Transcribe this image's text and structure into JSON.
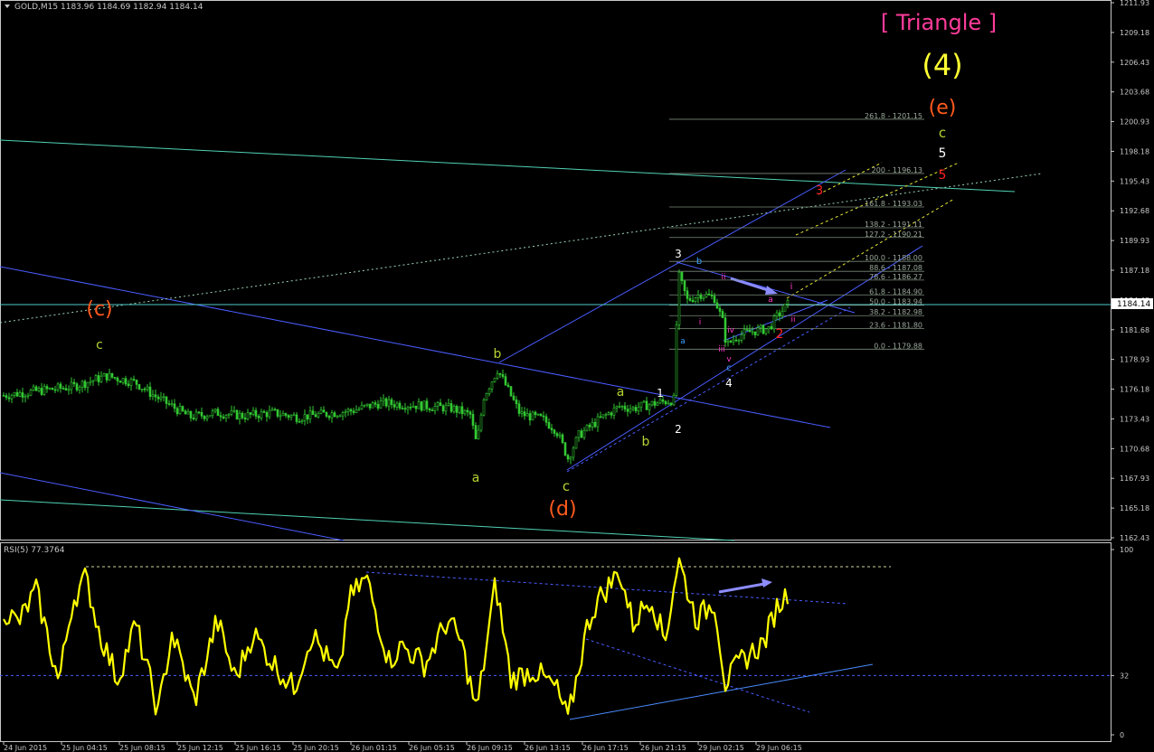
{
  "header": {
    "symbol_text": "GOLD,M15",
    "ohlc_text": "1183.96 1184.69 1182.94 1184.14"
  },
  "price_axis": {
    "ticks": [
      "1211.93",
      "1209.18",
      "1206.43",
      "1203.68",
      "1200.93",
      "1198.18",
      "1195.43",
      "1192.68",
      "1189.93",
      "1187.18",
      "1184.43",
      "1181.68",
      "1178.93",
      "1176.18",
      "1173.43",
      "1170.68",
      "1167.93",
      "1165.18",
      "1162.43"
    ],
    "current_price": "1184.14",
    "ylim": [
      1162.43,
      1211.93
    ]
  },
  "rsi": {
    "title": "RSI(5) 77.3764",
    "ticks": [
      "100",
      "32",
      "0"
    ],
    "levels": [
      100,
      32,
      0
    ]
  },
  "time_axis": {
    "labels": [
      "24 Jun 2015",
      "25 Jun 04:15",
      "25 Jun 08:15",
      "25 Jun 12:15",
      "25 Jun 16:15",
      "25 Jun 20:15",
      "26 Jun 01:15",
      "26 Jun 05:15",
      "26 Jun 09:15",
      "26 Jun 13:15",
      "26 Jun 17:15",
      "26 Jun 21:15",
      "29 Jun 02:15",
      "29 Jun 06:15"
    ]
  },
  "fibonacci": {
    "levels": [
      {
        "label": "261.8 - 1201.15",
        "price": 1201.15
      },
      {
        "label": "200 - 1196.13",
        "price": 1196.13
      },
      {
        "label": "161.8 - 1193.03",
        "price": 1193.03
      },
      {
        "label": "138.2 - 1191.11",
        "price": 1191.11
      },
      {
        "label": "127.2 - 1190.21",
        "price": 1190.21
      },
      {
        "label": "100.0 - 1188.00",
        "price": 1188.0
      },
      {
        "label": "88.6 - 1187.08",
        "price": 1187.08
      },
      {
        "label": "78.6 - 1186.27",
        "price": 1186.27
      },
      {
        "label": "61.8 - 1184.90",
        "price": 1184.9
      },
      {
        "label": "50.0 - 1183.94",
        "price": 1183.94
      },
      {
        "label": "38.2 - 1182.98",
        "price": 1182.98
      },
      {
        "label": "23.6 - 1181.80",
        "price": 1181.8
      },
      {
        "label": "0.0 - 1179.88",
        "price": 1179.88
      }
    ]
  },
  "annotations": [
    {
      "id": "triangle",
      "text": "[ Triangle ]",
      "color": "#ff3c9a"
    },
    {
      "id": "wave-4",
      "text": "(4)",
      "color": "#ffff33"
    },
    {
      "id": "wave-e",
      "text": "(e)",
      "color": "#ff5a1e"
    },
    {
      "id": "wave-c-top",
      "text": "c",
      "color": "#b4d432"
    },
    {
      "id": "wave-5-white",
      "text": "5",
      "color": "#ffffff"
    },
    {
      "id": "wave-5-red",
      "text": "5",
      "color": "#ff2020"
    },
    {
      "id": "wave-3-red",
      "text": "3",
      "color": "#ff2020"
    },
    {
      "id": "wave-paren-c",
      "text": "(c)",
      "color": "#ff5a1e"
    },
    {
      "id": "wave-c-left",
      "text": "c",
      "color": "#b4d432"
    },
    {
      "id": "wave-b-mid",
      "text": "b",
      "color": "#b4d432"
    },
    {
      "id": "wave-a-mid",
      "text": "a",
      "color": "#b4d432"
    },
    {
      "id": "wave-c-bottom",
      "text": "c",
      "color": "#b4d432"
    },
    {
      "id": "wave-paren-d",
      "text": "(d)",
      "color": "#ff5a1e"
    },
    {
      "id": "wave-a-right",
      "text": "a",
      "color": "#b4d432"
    },
    {
      "id": "wave-b-right",
      "text": "b",
      "color": "#b4d432"
    },
    {
      "id": "wave-1-white",
      "text": "1",
      "color": "#ffffff"
    },
    {
      "id": "wave-2-white",
      "text": "2",
      "color": "#ffffff"
    },
    {
      "id": "wave-3-white",
      "text": "3",
      "color": "#ffffff"
    },
    {
      "id": "wave-4-white",
      "text": "4",
      "color": "#ffffff"
    },
    {
      "id": "wave-2-red",
      "text": "2",
      "color": "#ff2020"
    },
    {
      "id": "wave-b-blue",
      "text": "b",
      "color": "#3aa0ff"
    },
    {
      "id": "wave-a-blue",
      "text": "a",
      "color": "#3aa0ff"
    },
    {
      "id": "wave-c-blue",
      "text": "c",
      "color": "#3aa0ff"
    },
    {
      "id": "wave-i-top",
      "text": "i",
      "color": "#ff3cc8"
    },
    {
      "id": "wave-i-small",
      "text": "i",
      "color": "#ff3cc8"
    },
    {
      "id": "wave-ii-small",
      "text": "ii",
      "color": "#ff3cc8"
    },
    {
      "id": "wave-iii-small",
      "text": "iii",
      "color": "#ff3cc8"
    },
    {
      "id": "wave-iv-small",
      "text": "iv",
      "color": "#ff3cc8"
    },
    {
      "id": "wave-v-small",
      "text": "v",
      "color": "#ff3cc8"
    },
    {
      "id": "wave-ii-right",
      "text": "ii",
      "color": "#ff3cc8"
    },
    {
      "id": "wave-a-mini",
      "text": "a",
      "color": "#ff3cc8"
    }
  ],
  "colors": {
    "background": "#000000",
    "candles": "#32c832",
    "rsi_line": "#ffff00",
    "channel_lines": "#4a5cff",
    "trend_teal": "#50d2b4",
    "fib_lines": "#7a8a7a",
    "axis_text": "#c8c8c8"
  },
  "chart_data": [
    {
      "type": "candlestick",
      "title": "GOLD,M15",
      "ylim": [
        1162.43,
        1211.93
      ],
      "x": [
        "24 Jun 2015",
        "25 Jun 04:15",
        "25 Jun 08:15",
        "25 Jun 12:15",
        "25 Jun 16:15",
        "25 Jun 20:15",
        "26 Jun 01:15",
        "26 Jun 05:15",
        "26 Jun 09:15",
        "26 Jun 13:15",
        "26 Jun 17:15",
        "26 Jun 21:15",
        "29 Jun 02:15",
        "29 Jun 06:15"
      ],
      "close_path": [
        [
          "24 Jun 2015",
          1175.6
        ],
        [
          "25 Jun 04:15",
          1177.4
        ],
        [
          "25 Jun 08:15",
          1176.2
        ],
        [
          "25 Jun 12:15",
          1174.1
        ],
        [
          "25 Jun 16:15",
          1173.8
        ],
        [
          "25 Jun 20:15",
          1173.9
        ],
        [
          "26 Jun 01:15",
          1174.9
        ],
        [
          "26 Jun 05:15",
          1174.7
        ],
        [
          "26 Jun 09:15",
          1177.8
        ],
        [
          "26 Jun 13:15",
          1171.4
        ],
        [
          "26 Jun 17:15",
          1174.6
        ],
        [
          "26 Jun 21:15",
          1175.2
        ],
        [
          "29 Jun 02:15",
          1181.3
        ],
        [
          "29 Jun 06:15",
          1184.1
        ]
      ],
      "series": [
        {
          "name": "GOLD,M15",
          "last": 1184.14
        }
      ]
    },
    {
      "type": "line",
      "title": "RSI(5) 77.3764",
      "ylim": [
        0,
        100
      ],
      "x": [
        "24 Jun 2015",
        "25 Jun 04:15",
        "25 Jun 08:15",
        "25 Jun 12:15",
        "25 Jun 16:15",
        "25 Jun 20:15",
        "26 Jun 01:15",
        "26 Jun 05:15",
        "26 Jun 09:15",
        "26 Jun 13:15",
        "26 Jun 17:15",
        "26 Jun 21:15",
        "29 Jun 02:15",
        "29 Jun 06:15"
      ],
      "series": [
        {
          "name": "RSI(5)",
          "values": [
            68,
            80,
            28,
            45,
            40,
            48,
            82,
            52,
            65,
            8,
            72,
            92,
            30,
            77.3764
          ]
        }
      ],
      "levels": [
        32
      ]
    }
  ]
}
